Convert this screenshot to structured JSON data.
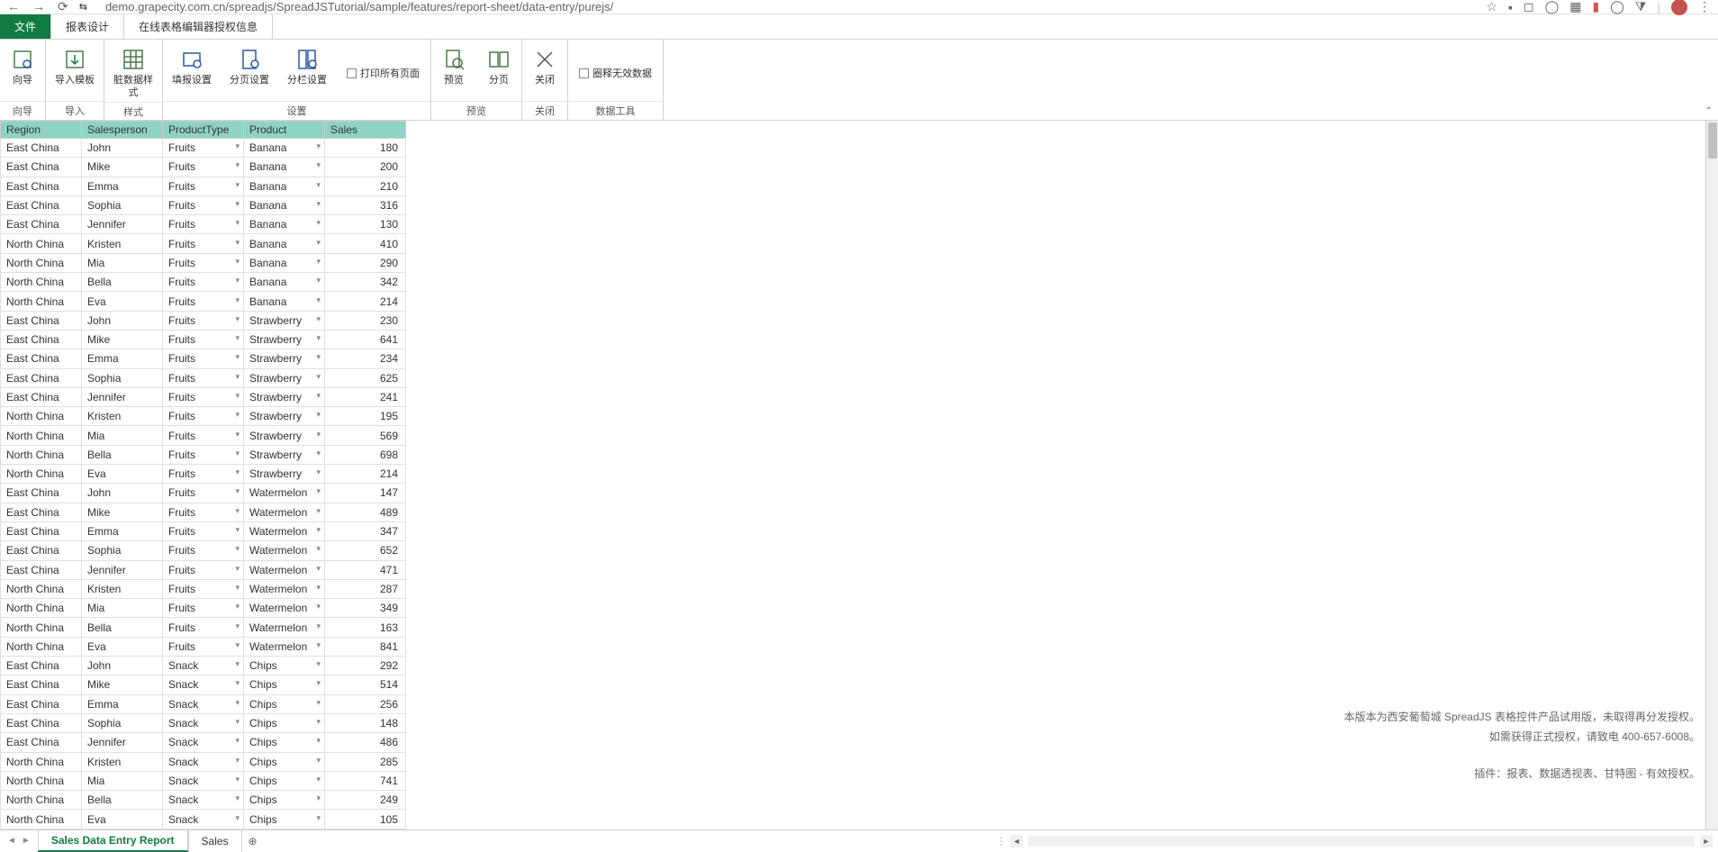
{
  "browser": {
    "url": "demo.grapecity.com.cn/spreadjs/SpreadJSTutorial/sample/features/report-sheet/data-entry/purejs/",
    "star": "☆"
  },
  "tabs": {
    "file": "文件",
    "design": "报表设计",
    "license": "在线表格编辑器授权信息"
  },
  "ribbon": {
    "wizard": "向导",
    "import_tpl": "导入模板",
    "dirty_style": "脏数据样\n式",
    "fill_setting": "填报设置",
    "page_setting": "分页设置",
    "column_setting": "分栏设置",
    "print_all": "打印所有页面",
    "preview": "预览",
    "paginate": "分页",
    "close": "关闭",
    "circle_invalid": "圈释无效数据",
    "grp_wizard": "向导",
    "grp_import": "导入",
    "grp_style": "样式",
    "grp_setting": "设置",
    "grp_preview": "预览",
    "grp_close": "关闭",
    "grp_datatool": "数据工具"
  },
  "headers": {
    "region": "Region",
    "salesperson": "Salesperson",
    "producttype": "ProductType",
    "product": "Product",
    "sales": "Sales"
  },
  "rows": [
    {
      "region": "East China",
      "sp": "John",
      "pt": "Fruits",
      "pr": "Banana",
      "sales": 180
    },
    {
      "region": "East China",
      "sp": "Mike",
      "pt": "Fruits",
      "pr": "Banana",
      "sales": 200
    },
    {
      "region": "East China",
      "sp": "Emma",
      "pt": "Fruits",
      "pr": "Banana",
      "sales": 210
    },
    {
      "region": "East China",
      "sp": "Sophia",
      "pt": "Fruits",
      "pr": "Banana",
      "sales": 316
    },
    {
      "region": "East China",
      "sp": "Jennifer",
      "pt": "Fruits",
      "pr": "Banana",
      "sales": 130
    },
    {
      "region": "North China",
      "sp": "Kristen",
      "pt": "Fruits",
      "pr": "Banana",
      "sales": 410
    },
    {
      "region": "North China",
      "sp": "Mia",
      "pt": "Fruits",
      "pr": "Banana",
      "sales": 290
    },
    {
      "region": "North China",
      "sp": "Bella",
      "pt": "Fruits",
      "pr": "Banana",
      "sales": 342
    },
    {
      "region": "North China",
      "sp": "Eva",
      "pt": "Fruits",
      "pr": "Banana",
      "sales": 214
    },
    {
      "region": "East China",
      "sp": "John",
      "pt": "Fruits",
      "pr": "Strawberry",
      "sales": 230
    },
    {
      "region": "East China",
      "sp": "Mike",
      "pt": "Fruits",
      "pr": "Strawberry",
      "sales": 641
    },
    {
      "region": "East China",
      "sp": "Emma",
      "pt": "Fruits",
      "pr": "Strawberry",
      "sales": 234
    },
    {
      "region": "East China",
      "sp": "Sophia",
      "pt": "Fruits",
      "pr": "Strawberry",
      "sales": 625
    },
    {
      "region": "East China",
      "sp": "Jennifer",
      "pt": "Fruits",
      "pr": "Strawberry",
      "sales": 241
    },
    {
      "region": "North China",
      "sp": "Kristen",
      "pt": "Fruits",
      "pr": "Strawberry",
      "sales": 195
    },
    {
      "region": "North China",
      "sp": "Mia",
      "pt": "Fruits",
      "pr": "Strawberry",
      "sales": 569
    },
    {
      "region": "North China",
      "sp": "Bella",
      "pt": "Fruits",
      "pr": "Strawberry",
      "sales": 698
    },
    {
      "region": "North China",
      "sp": "Eva",
      "pt": "Fruits",
      "pr": "Strawberry",
      "sales": 214
    },
    {
      "region": "East China",
      "sp": "John",
      "pt": "Fruits",
      "pr": "Watermelon",
      "sales": 147
    },
    {
      "region": "East China",
      "sp": "Mike",
      "pt": "Fruits",
      "pr": "Watermelon",
      "sales": 489
    },
    {
      "region": "East China",
      "sp": "Emma",
      "pt": "Fruits",
      "pr": "Watermelon",
      "sales": 347
    },
    {
      "region": "East China",
      "sp": "Sophia",
      "pt": "Fruits",
      "pr": "Watermelon",
      "sales": 652
    },
    {
      "region": "East China",
      "sp": "Jennifer",
      "pt": "Fruits",
      "pr": "Watermelon",
      "sales": 471
    },
    {
      "region": "North China",
      "sp": "Kristen",
      "pt": "Fruits",
      "pr": "Watermelon",
      "sales": 287
    },
    {
      "region": "North China",
      "sp": "Mia",
      "pt": "Fruits",
      "pr": "Watermelon",
      "sales": 349
    },
    {
      "region": "North China",
      "sp": "Bella",
      "pt": "Fruits",
      "pr": "Watermelon",
      "sales": 163
    },
    {
      "region": "North China",
      "sp": "Eva",
      "pt": "Fruits",
      "pr": "Watermelon",
      "sales": 841
    },
    {
      "region": "East China",
      "sp": "John",
      "pt": "Snack",
      "pr": "Chips",
      "sales": 292
    },
    {
      "region": "East China",
      "sp": "Mike",
      "pt": "Snack",
      "pr": "Chips",
      "sales": 514
    },
    {
      "region": "East China",
      "sp": "Emma",
      "pt": "Snack",
      "pr": "Chips",
      "sales": 256
    },
    {
      "region": "East China",
      "sp": "Sophia",
      "pt": "Snack",
      "pr": "Chips",
      "sales": 148
    },
    {
      "region": "East China",
      "sp": "Jennifer",
      "pt": "Snack",
      "pr": "Chips",
      "sales": 486
    },
    {
      "region": "North China",
      "sp": "Kristen",
      "pt": "Snack",
      "pr": "Chips",
      "sales": 285
    },
    {
      "region": "North China",
      "sp": "Mia",
      "pt": "Snack",
      "pr": "Chips",
      "sales": 741
    },
    {
      "region": "North China",
      "sp": "Bella",
      "pt": "Snack",
      "pr": "Chips",
      "sales": 249
    },
    {
      "region": "North China",
      "sp": "Eva",
      "pt": "Snack",
      "pr": "Chips",
      "sales": 105
    }
  ],
  "watermark": {
    "line1": "本版本为西安葡萄城 SpreadJS 表格控件产品试用版，未取得再分发授权。",
    "line2": "如需获得正式授权，请致电 400-657-6008。",
    "line3": "插件：报表、数据透视表、甘特图 - 有效授权。"
  },
  "sheets": {
    "active": "Sales Data Entry Report",
    "other": "Sales"
  }
}
